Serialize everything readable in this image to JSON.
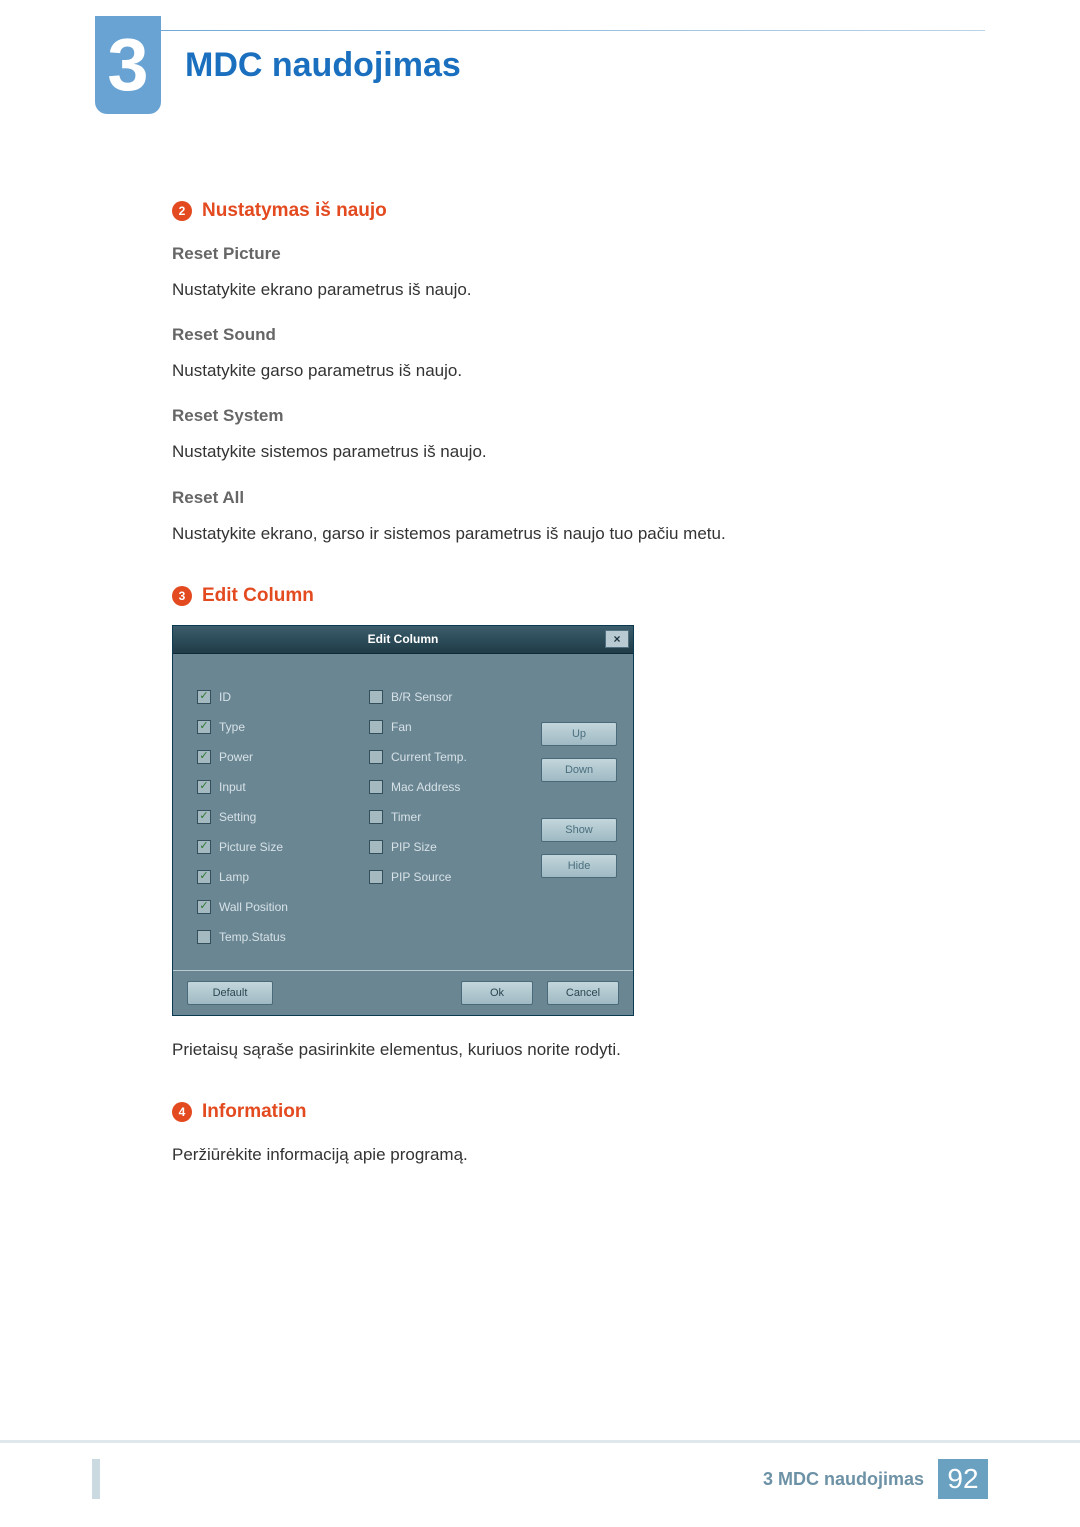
{
  "chapter": {
    "number": "3",
    "title": "MDC naudojimas"
  },
  "sections": {
    "s2": {
      "badge": "2",
      "title": "Nustatymas iš naujo",
      "items": [
        {
          "title": "Reset Picture",
          "text": "Nustatykite ekrano parametrus iš naujo."
        },
        {
          "title": "Reset Sound",
          "text": "Nustatykite garso parametrus iš naujo."
        },
        {
          "title": "Reset System",
          "text": "Nustatykite sistemos parametrus iš naujo."
        },
        {
          "title": "Reset All",
          "text": "Nustatykite ekrano, garso ir sistemos parametrus iš naujo tuo pačiu metu."
        }
      ]
    },
    "s3": {
      "badge": "3",
      "title": "Edit Column",
      "caption": "Prietaisų sąraše pasirinkite elementus, kuriuos norite rodyti."
    },
    "s4": {
      "badge": "4",
      "title": "Information",
      "text": "Peržiūrėkite informaciją apie programą."
    }
  },
  "dialog": {
    "title": "Edit Column",
    "close": "×",
    "col1": [
      {
        "label": "ID",
        "checked": true
      },
      {
        "label": "Type",
        "checked": true
      },
      {
        "label": "Power",
        "checked": true
      },
      {
        "label": "Input",
        "checked": true
      },
      {
        "label": "Setting",
        "checked": true
      },
      {
        "label": "Picture Size",
        "checked": true
      },
      {
        "label": "Lamp",
        "checked": true
      },
      {
        "label": "Wall Position",
        "checked": true
      },
      {
        "label": "Temp.Status",
        "checked": false
      }
    ],
    "col2": [
      {
        "label": "B/R Sensor",
        "checked": false
      },
      {
        "label": "Fan",
        "checked": false
      },
      {
        "label": "Current Temp.",
        "checked": false
      },
      {
        "label": "Mac Address",
        "checked": false
      },
      {
        "label": "Timer",
        "checked": false
      },
      {
        "label": "PIP Size",
        "checked": false
      },
      {
        "label": "PIP Source",
        "checked": false
      }
    ],
    "buttons": {
      "up": "Up",
      "down": "Down",
      "show": "Show",
      "hide": "Hide",
      "default": "Default",
      "ok": "Ok",
      "cancel": "Cancel"
    }
  },
  "footer": {
    "text": "3 MDC naudojimas",
    "page": "92"
  }
}
